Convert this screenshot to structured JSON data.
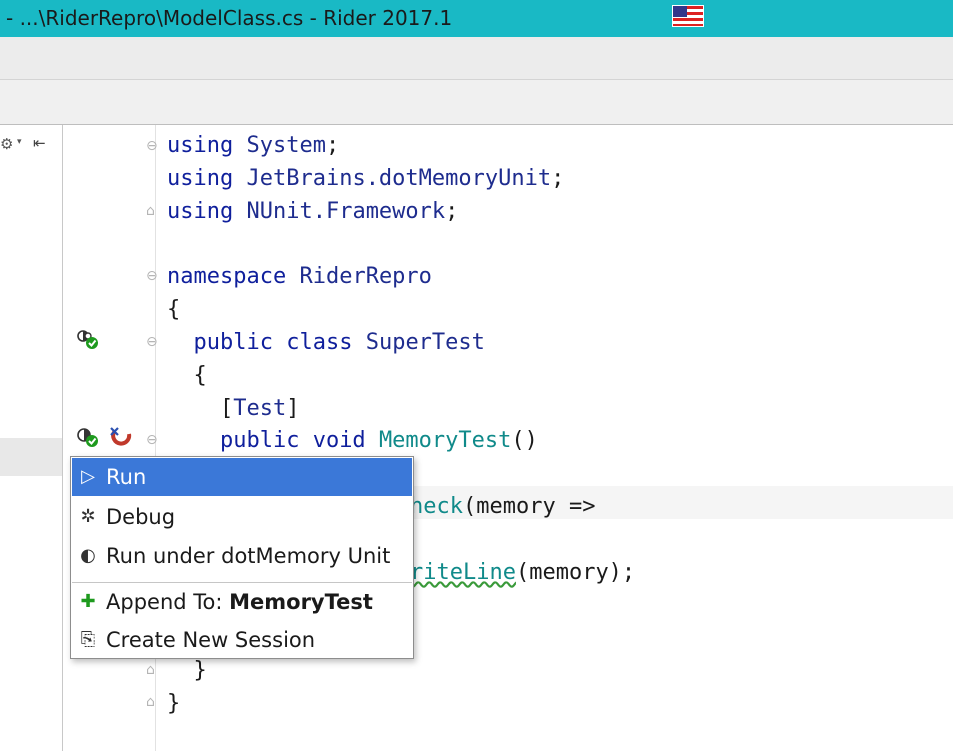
{
  "window": {
    "title": "- ...\\RiderRepro\\ModelClass.cs - Rider 2017.1",
    "flag_icon": "us-flag-icon"
  },
  "toolbar": {
    "settings_glyph": "⚙",
    "caret_glyph": "▾",
    "collapse_glyph": "⇤"
  },
  "editor": {
    "lines": [
      "using System;",
      "using JetBrains.dotMemoryUnit;",
      "using NUnit.Framework;",
      "namespace RiderRepro",
      "{",
      "public class SuperTest",
      "{",
      "[Test]",
      "public void MemoryTest()",
      "heck(memory =>",
      "riteLine(memory);",
      "}",
      "}"
    ]
  },
  "context_menu": {
    "items": [
      {
        "label": "Run",
        "icon": "run-icon",
        "glyph": "▷"
      },
      {
        "label": "Debug",
        "icon": "bug-icon",
        "glyph": "✲"
      },
      {
        "label": "Run under dotMemory Unit",
        "icon": "memory-unit-icon",
        "glyph": "◐"
      },
      {
        "label_prefix": "Append To: ",
        "label_bold": "MemoryTest",
        "icon": "plus-icon",
        "glyph": "✚"
      },
      {
        "label": "Create New Session",
        "icon": "new-session-icon",
        "glyph": "⎘"
      }
    ],
    "selected_index": 0
  },
  "colors": {
    "titlebar": "#19b9c5",
    "keyword": "#0f1f9c",
    "method": "#108a8a",
    "menu_selection": "#3b78d8",
    "run_green": "#1e9a1e"
  }
}
